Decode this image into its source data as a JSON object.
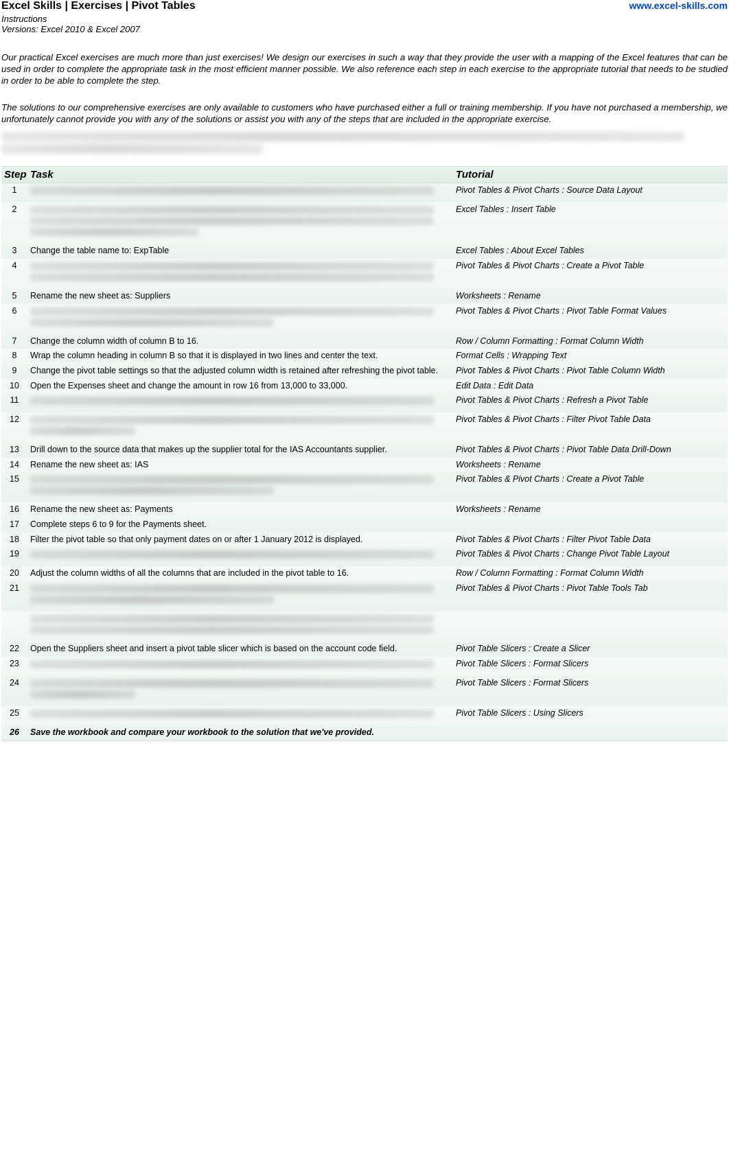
{
  "header": {
    "title": "Excel Skills | Exercises | Pivot Tables",
    "site": "www.excel-skills.com",
    "instructions": "Instructions",
    "versions": "Versions: Excel 2010 & Excel 2007"
  },
  "intro": {
    "p1": "Our practical Excel exercises are much more than just exercises! We design our exercises in such a way that they provide the user with a mapping of the Excel features that can be used in order to complete the appropriate task in the most efficient manner possible. We also reference each step in each exercise to the appropriate tutorial that needs to be studied in order to be able to complete the step.",
    "p2": "The solutions to our comprehensive exercises are only available to customers who have purchased either a full or training membership. If you have not purchased a membership, we unfortunately cannot provide you with any of the solutions or assist you with any of the steps that are included in the appropriate exercise."
  },
  "table": {
    "headers": {
      "step": "Step",
      "task": "Task",
      "tutorial": "Tutorial"
    },
    "rows": [
      {
        "step": "1",
        "task": "",
        "tutorial": "Pivot Tables & Pivot Charts : Source Data Layout",
        "blurred": true,
        "lines": 1,
        "widths": [
          "bw95"
        ]
      },
      {
        "step": "2",
        "task": "",
        "tutorial": "Excel Tables : Insert Table",
        "blurred": true,
        "lines": 3,
        "widths": [
          "bw95",
          "bw95",
          "bw40"
        ]
      },
      {
        "step": "3",
        "task": "Change the table name to: ExpTable",
        "tutorial": "Excel Tables : About Excel Tables",
        "blurred": false
      },
      {
        "step": "4",
        "task": "",
        "tutorial": "Pivot Tables & Pivot Charts : Create a Pivot Table",
        "blurred": true,
        "lines": 2,
        "widths": [
          "bw95",
          "bw95"
        ]
      },
      {
        "step": "5",
        "task": "Rename the new sheet as: Suppliers",
        "tutorial": "Worksheets : Rename",
        "blurred": false
      },
      {
        "step": "6",
        "task": "",
        "tutorial": "Pivot Tables & Pivot Charts : Pivot Table Format Values",
        "blurred": true,
        "lines": 2,
        "widths": [
          "bw95",
          "bw60"
        ]
      },
      {
        "step": "7",
        "task": "Change the column width of column B to 16.",
        "tutorial": "Row / Column Formatting : Format Column Width",
        "blurred": false
      },
      {
        "step": "8",
        "task": "Wrap the column heading in column B so that it is displayed in two lines and center the text.",
        "tutorial": "Format Cells : Wrapping Text",
        "blurred": false
      },
      {
        "step": "9",
        "task": "Change the pivot table settings so that the adjusted column width is retained after refreshing the pivot table.",
        "tutorial": "Pivot Tables & Pivot Charts : Pivot Table Column Width",
        "blurred": false
      },
      {
        "step": "10",
        "task": "Open the Expenses sheet and change the amount in row 16 from 13,000 to 33,000.",
        "tutorial": "Edit Data : Edit Data",
        "blurred": false
      },
      {
        "step": "11",
        "task": "",
        "tutorial": "Pivot Tables & Pivot Charts : Refresh a Pivot Table",
        "blurred": true,
        "lines": 1,
        "widths": [
          "bw95"
        ]
      },
      {
        "step": "12",
        "task": "",
        "tutorial": "Pivot Tables & Pivot Charts : Filter Pivot Table Data",
        "blurred": true,
        "lines": 2,
        "widths": [
          "bw95",
          "bw25"
        ]
      },
      {
        "step": "13",
        "task": "Drill down to the source data that makes up the supplier total for the IAS Accountants supplier.",
        "tutorial": "Pivot Tables & Pivot Charts : Pivot Table Data Drill-Down",
        "blurred": false
      },
      {
        "step": "14",
        "task": "Rename the new sheet as: IAS",
        "tutorial": "Worksheets : Rename",
        "blurred": false
      },
      {
        "step": "15",
        "task": "",
        "tutorial": "Pivot Tables & Pivot Charts : Create a Pivot Table",
        "blurred": true,
        "lines": 2,
        "widths": [
          "bw95",
          "bw60"
        ]
      },
      {
        "step": "16",
        "task": "Rename the new sheet as: Payments",
        "tutorial": "Worksheets : Rename",
        "blurred": false
      },
      {
        "step": "17",
        "task": "Complete steps 6 to 9 for the Payments sheet.",
        "tutorial": "",
        "blurred": false
      },
      {
        "step": "18",
        "task": "Filter the pivot table so that only payment dates on or after 1 January 2012 is displayed.",
        "tutorial": "Pivot Tables & Pivot Charts : Filter Pivot Table Data",
        "blurred": false
      },
      {
        "step": "19",
        "task": "",
        "tutorial": "Pivot Tables & Pivot Charts : Change Pivot Table Layout",
        "blurred": true,
        "lines": 1,
        "widths": [
          "bw95"
        ]
      },
      {
        "step": "20",
        "task": "Adjust the column widths of all the columns that are included in the pivot table to 16.",
        "tutorial": "Row / Column Formatting : Format Column Width",
        "blurred": false
      },
      {
        "step": "21",
        "task": "",
        "tutorial": "Pivot Tables & Pivot Charts : Pivot Table Tools Tab",
        "blurred": true,
        "lines": 2,
        "widths": [
          "bw95",
          "bw60"
        ]
      },
      {
        "step": "",
        "task": "",
        "tutorial": "",
        "blurred": true,
        "lines": 2,
        "widths": [
          "bw95",
          "bw95"
        ]
      },
      {
        "step": "22",
        "task": "Open the Suppliers sheet and insert a pivot table slicer which is based on the account code field.",
        "tutorial": "Pivot Table Slicers : Create a Slicer",
        "blurred": false
      },
      {
        "step": "23",
        "task": "",
        "tutorial": "Pivot Table Slicers : Format Slicers",
        "blurred": true,
        "lines": 1,
        "widths": [
          "bw95"
        ]
      },
      {
        "step": "24",
        "task": "",
        "tutorial": "Pivot Table Slicers : Format Slicers",
        "blurred": true,
        "lines": 2,
        "widths": [
          "bw95",
          "bw25"
        ]
      },
      {
        "step": "25",
        "task": "",
        "tutorial": "Pivot Table Slicers : Using Slicers",
        "blurred": true,
        "lines": 1,
        "widths": [
          "bw95"
        ]
      },
      {
        "step": "26",
        "task": "Save the workbook and compare your workbook to the solution that we've provided.",
        "tutorial": "",
        "blurred": false,
        "final": true
      }
    ]
  }
}
